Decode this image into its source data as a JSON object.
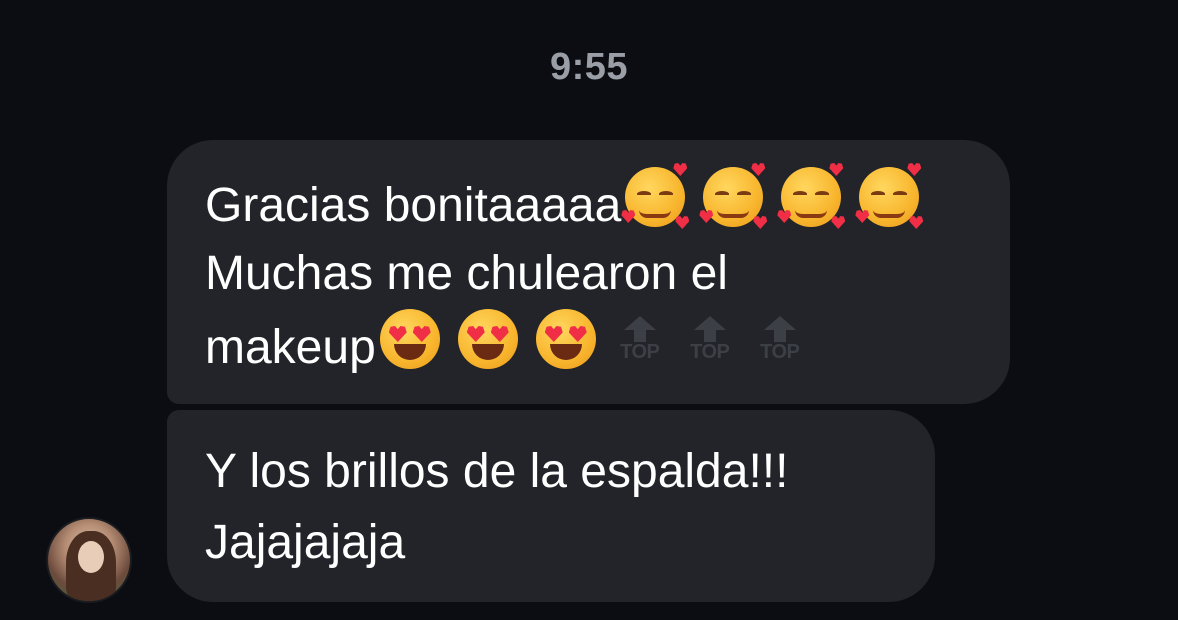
{
  "timestamp": "9:55",
  "messages": [
    {
      "lines": [
        "Gracias bonitaaaaa",
        "Muchas me chulearon el",
        "makeup"
      ],
      "emoji_line1": [
        "smiling-face-with-hearts",
        "smiling-face-with-hearts",
        "smiling-face-with-hearts",
        "smiling-face-with-hearts"
      ],
      "emoji_line3": [
        "heart-eyes",
        "heart-eyes",
        "heart-eyes",
        "top-arrow",
        "top-arrow",
        "top-arrow"
      ],
      "top_label": "TOP"
    },
    {
      "lines": [
        "Y los brillos de la espalda!!!",
        "Jajajajaja"
      ]
    }
  ],
  "colors": {
    "background": "#0b0d12",
    "bubble": "#222429",
    "text": "#ffffff",
    "timestamp": "#9a9ea6"
  }
}
